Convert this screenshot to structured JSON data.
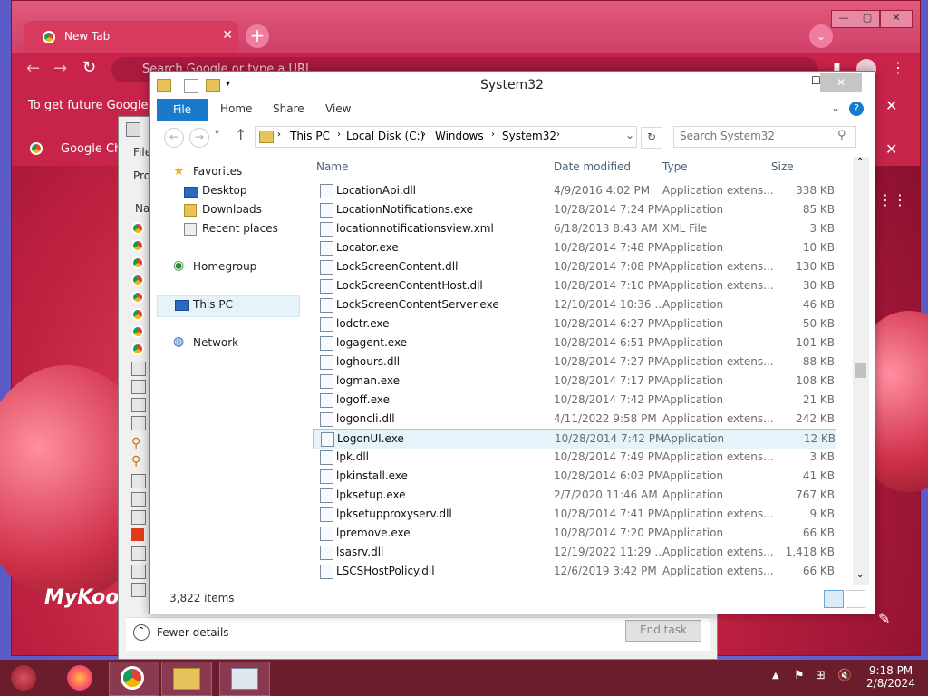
{
  "chrome": {
    "tab_title": "New Tab",
    "omnibox_placeholder": "Search Google or type a URL",
    "infobar_text": "To get future Google Chrome updates...",
    "infobar2_text": "Google Chrome",
    "brand_text": "MyKoo"
  },
  "taskmgr": {
    "fewer_details": "Fewer details",
    "end_task": "End task",
    "menu_file": "File",
    "tab_proc": "Pro",
    "col_name": "Na"
  },
  "explorer": {
    "title": "System32",
    "ribbon": {
      "file": "File",
      "home": "Home",
      "share": "Share",
      "view": "View"
    },
    "breadcrumb": [
      "This PC",
      "Local Disk (C:)",
      "Windows",
      "System32"
    ],
    "search_placeholder": "Search System32",
    "nav": {
      "favorites": "Favorites",
      "desktop": "Desktop",
      "downloads": "Downloads",
      "recent": "Recent places",
      "homegroup": "Homegroup",
      "thispc": "This PC",
      "network": "Network"
    },
    "columns": {
      "name": "Name",
      "date": "Date modified",
      "type": "Type",
      "size": "Size"
    },
    "rows": [
      {
        "name": "LocationApi.dll",
        "date": "4/9/2016 4:02 PM",
        "type": "Application extens...",
        "size": "338 KB"
      },
      {
        "name": "LocationNotifications.exe",
        "date": "10/28/2014 7:24 PM",
        "type": "Application",
        "size": "85 KB"
      },
      {
        "name": "locationnotificationsview.xml",
        "date": "6/18/2013 8:43 AM",
        "type": "XML File",
        "size": "3 KB"
      },
      {
        "name": "Locator.exe",
        "date": "10/28/2014 7:48 PM",
        "type": "Application",
        "size": "10 KB"
      },
      {
        "name": "LockScreenContent.dll",
        "date": "10/28/2014 7:08 PM",
        "type": "Application extens...",
        "size": "130 KB"
      },
      {
        "name": "LockScreenContentHost.dll",
        "date": "10/28/2014 7:10 PM",
        "type": "Application extens...",
        "size": "30 KB"
      },
      {
        "name": "LockScreenContentServer.exe",
        "date": "12/10/2014 10:36 ...",
        "type": "Application",
        "size": "46 KB"
      },
      {
        "name": "lodctr.exe",
        "date": "10/28/2014 6:27 PM",
        "type": "Application",
        "size": "50 KB"
      },
      {
        "name": "logagent.exe",
        "date": "10/28/2014 6:51 PM",
        "type": "Application",
        "size": "101 KB"
      },
      {
        "name": "loghours.dll",
        "date": "10/28/2014 7:27 PM",
        "type": "Application extens...",
        "size": "88 KB"
      },
      {
        "name": "logman.exe",
        "date": "10/28/2014 7:17 PM",
        "type": "Application",
        "size": "108 KB"
      },
      {
        "name": "logoff.exe",
        "date": "10/28/2014 7:42 PM",
        "type": "Application",
        "size": "21 KB"
      },
      {
        "name": "logoncli.dll",
        "date": "4/11/2022 9:58 PM",
        "type": "Application extens...",
        "size": "242 KB"
      },
      {
        "name": "LogonUI.exe",
        "date": "10/28/2014 7:42 PM",
        "type": "Application",
        "size": "12 KB"
      },
      {
        "name": "lpk.dll",
        "date": "10/28/2014 7:49 PM",
        "type": "Application extens...",
        "size": "3 KB"
      },
      {
        "name": "lpkinstall.exe",
        "date": "10/28/2014 6:03 PM",
        "type": "Application",
        "size": "41 KB"
      },
      {
        "name": "lpksetup.exe",
        "date": "2/7/2020 11:46 AM",
        "type": "Application",
        "size": "767 KB"
      },
      {
        "name": "lpksetupproxyserv.dll",
        "date": "10/28/2014 7:41 PM",
        "type": "Application extens...",
        "size": "9 KB"
      },
      {
        "name": "lpremove.exe",
        "date": "10/28/2014 7:20 PM",
        "type": "Application",
        "size": "66 KB"
      },
      {
        "name": "lsasrv.dll",
        "date": "12/19/2022 11:29 ...",
        "type": "Application extens...",
        "size": "1,418 KB"
      },
      {
        "name": "LSCSHostPolicy.dll",
        "date": "12/6/2019 3:42 PM",
        "type": "Application extens...",
        "size": "66 KB"
      }
    ],
    "status": "3,822 items"
  },
  "taskbar": {
    "time": "9:18 PM",
    "date": "2/8/2024"
  }
}
